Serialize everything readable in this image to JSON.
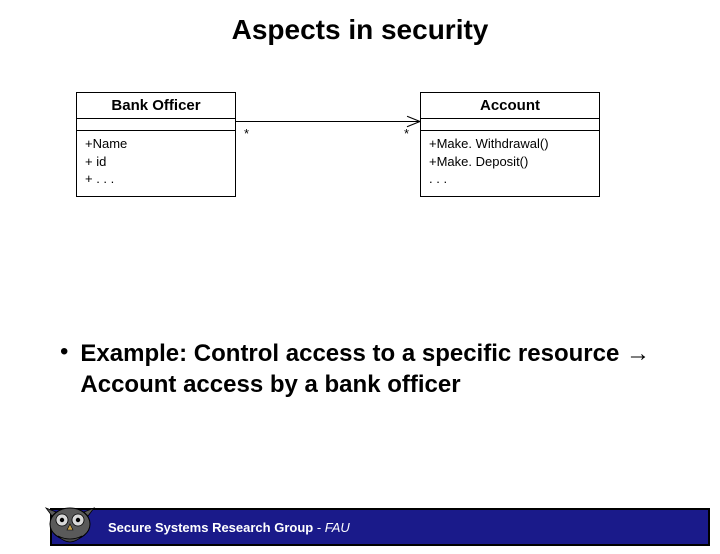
{
  "title": "Aspects in security",
  "uml": {
    "left": {
      "name": "Bank Officer",
      "ops": "+Name\n+ id\n+ . . ."
    },
    "right": {
      "name": "Account",
      "ops": "+Make. Withdrawal()\n+Make. Deposit()\n. . ."
    },
    "mult_left": "*",
    "mult_right": "*"
  },
  "bullet": {
    "pre": "Example: Control access to a specific resource ",
    "arrow": "→",
    "post": " Account access by a bank officer"
  },
  "footer": {
    "group": "Secure Systems Research Group",
    "sep": " - ",
    "org": "FAU"
  }
}
